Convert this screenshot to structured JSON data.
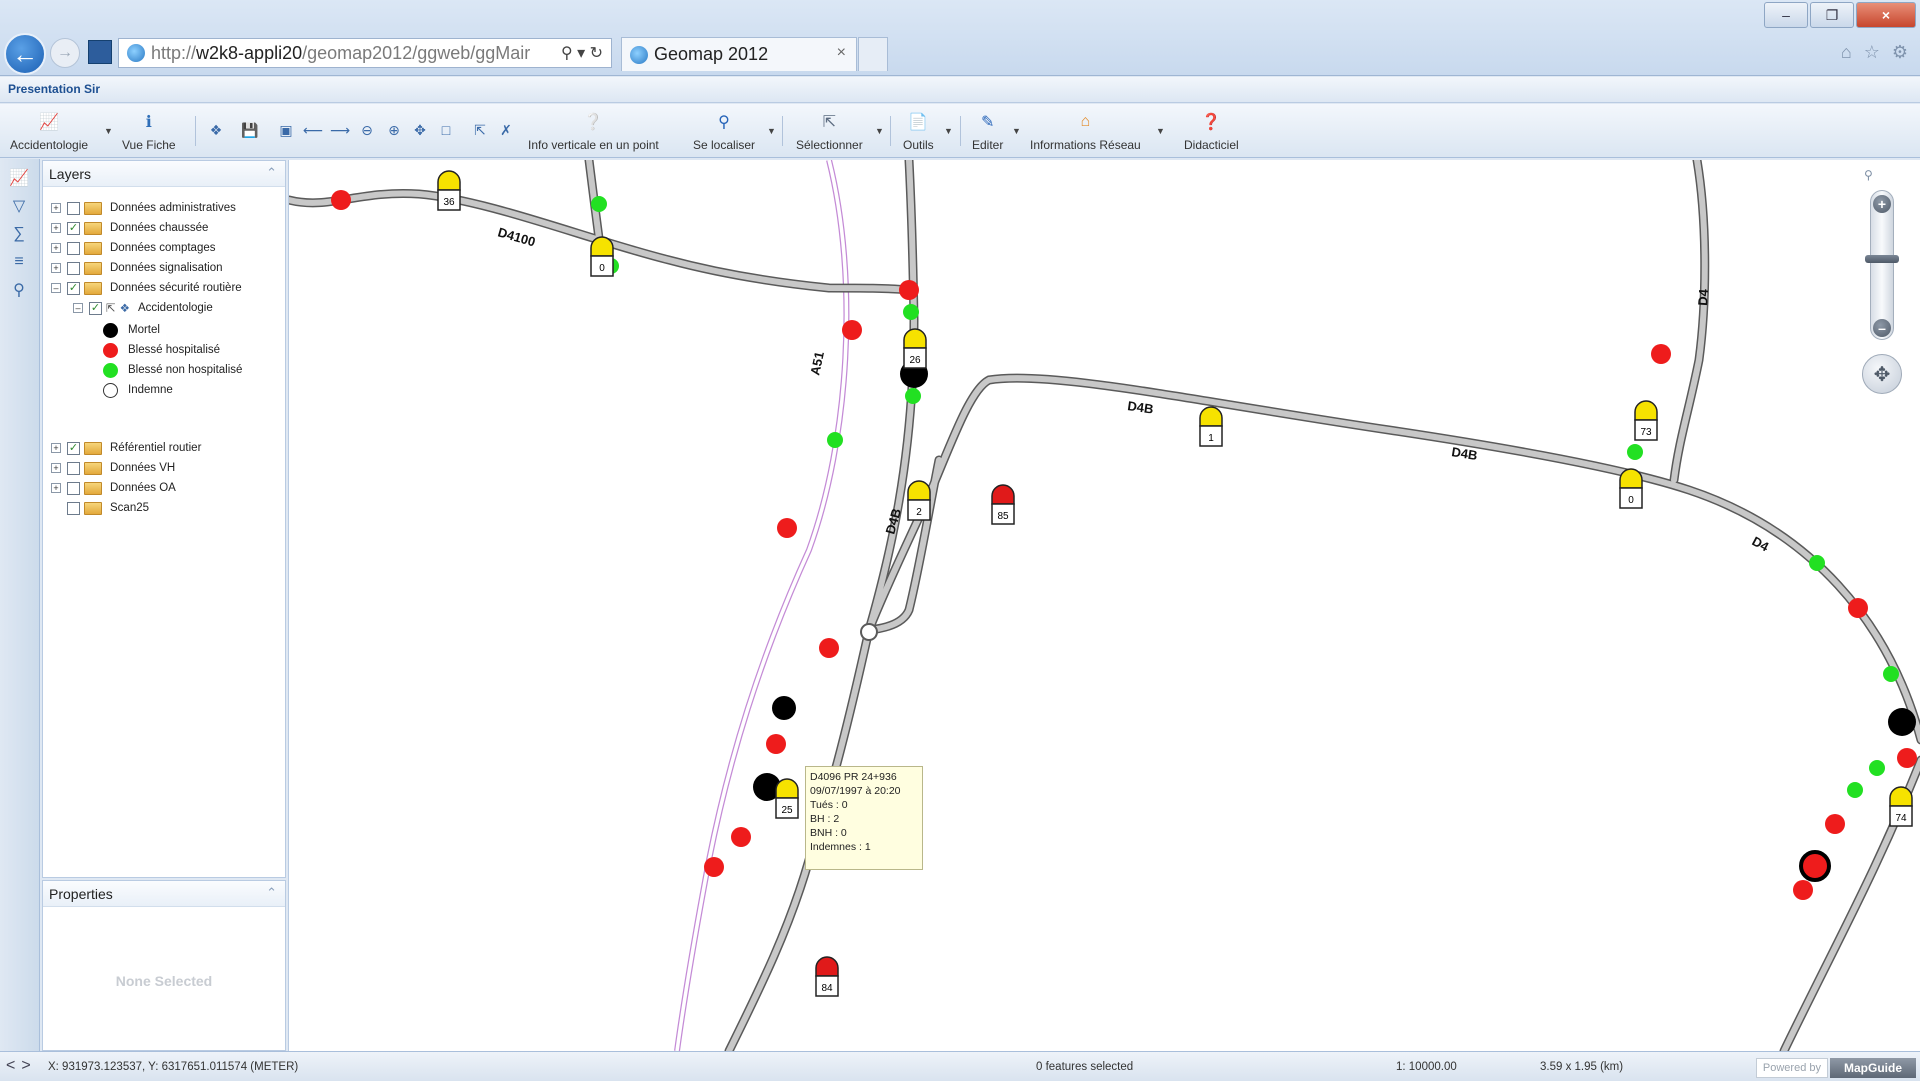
{
  "browser": {
    "url_prefix": "http://",
    "url_host": "w2k8-appli20",
    "url_path": "/geomap2012/ggweb/ggMair",
    "tab_title": "Geomap 2012"
  },
  "app": {
    "title": "Presentation Sir"
  },
  "toolbar": {
    "accidentologie": "Accidentologie",
    "vue_fiche": "Vue Fiche",
    "info_verticale": "Info verticale en un point",
    "se_localiser": "Se localiser",
    "selectionner": "Sélectionner",
    "outils": "Outils",
    "editer": "Editer",
    "informations_reseau": "Informations Réseau",
    "didacticiel": "Didacticiel"
  },
  "layers": {
    "title": "Layers",
    "items": [
      {
        "label": "Données administratives",
        "checked": false
      },
      {
        "label": "Données chaussée",
        "checked": true
      },
      {
        "label": "Données comptages",
        "checked": false
      },
      {
        "label": "Données signalisation",
        "checked": false
      },
      {
        "label": "Données sécurité routière",
        "checked": true
      },
      {
        "label": "Accidentologie",
        "checked": true
      },
      {
        "label": "Référentiel routier",
        "checked": true
      },
      {
        "label": "Données VH",
        "checked": false
      },
      {
        "label": "Données OA",
        "checked": false
      },
      {
        "label": "Scan25",
        "checked": false
      }
    ],
    "legend": [
      {
        "label": "Mortel",
        "color": "#000000"
      },
      {
        "label": "Blessé hospitalisé",
        "color": "#ee1c1c"
      },
      {
        "label": "Blessé non hospitalisé",
        "color": "#22e022"
      },
      {
        "label": "Indemne",
        "color": "#ffffff"
      }
    ]
  },
  "properties": {
    "title": "Properties",
    "empty_text": "None Selected"
  },
  "map": {
    "road_labels": [
      "D4100",
      "D4B",
      "D4B",
      "D4B",
      "D4",
      "D4",
      "A51"
    ],
    "pr_markers": [
      "36",
      "0",
      "26",
      "1",
      "73",
      "0",
      "2",
      "85",
      "25",
      "84",
      "74"
    ],
    "tooltip": {
      "line1": "D4096 PR 24+936",
      "line2": "09/07/1997 à 20:20",
      "line3": "Tués : 0",
      "line4": "BH : 2",
      "line5": "BNH : 0",
      "line6": "Indemnes : 1"
    }
  },
  "status": {
    "coords": "X: 931973.123537, Y: 6317651.011574 (METER)",
    "features": "0 features selected",
    "scale": "1: 10000.00",
    "extent": "3.59 x 1.95 (km)",
    "powered_by": "Powered by",
    "brand": "MapGuide"
  }
}
